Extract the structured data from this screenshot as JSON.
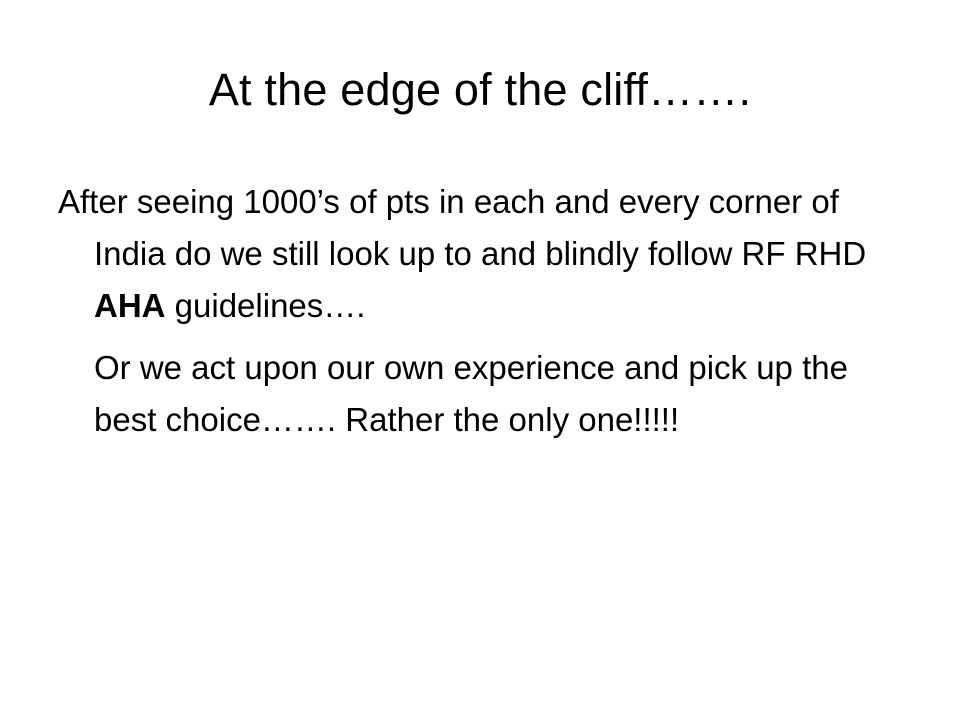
{
  "slide": {
    "title": "At the edge of the cliff…….",
    "paragraph1": {
      "before_bold": "After seeing 1000’s of pts in each and every corner of India do we still look up to and blindly follow RF RHD ",
      "bold": "AHA",
      "after_bold": " guidelines…."
    },
    "paragraph2": "Or we act upon our own experience and pick up the best choice……. Rather  the only one!!!!!"
  }
}
